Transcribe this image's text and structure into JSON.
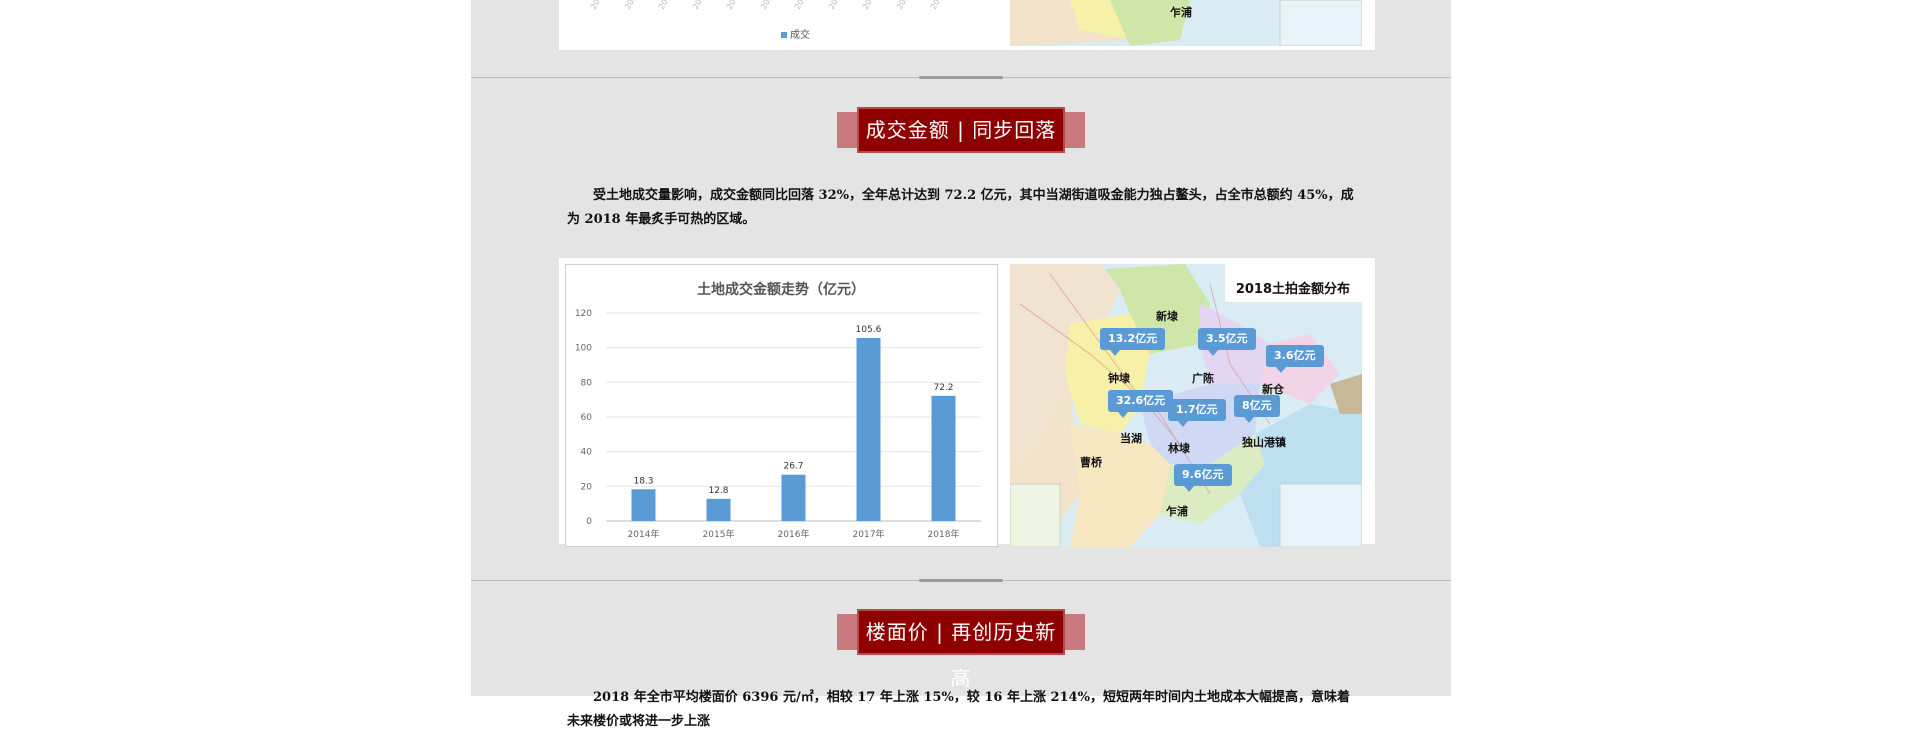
{
  "colors": {
    "column_bg": "#e4e4e4",
    "title_bg": "#8e0000",
    "title_wing": "#c97a7f",
    "bar": "#5b9bd5",
    "callout": "#5b9bd5",
    "page_bg": "#ffffff"
  },
  "top_section": {
    "legend_label": "成交",
    "map_place": "乍浦"
  },
  "section_amount": {
    "heading": "成交金额 | 同步回落",
    "paragraph": "受土地成交量影响，成交金额同比回落 32%，全年总计达到 72.2 亿元，其中当湖街道吸金能力独占鳌头，占全市总额约 45%，成为 2018 年最炙手可热的区域。",
    "chart_title": "土地成交金额走势（亿元）",
    "map_title": "2018土拍金额分布",
    "map_callouts": [
      "13.2亿元",
      "3.5亿元",
      "3.6亿元",
      "32.6亿元",
      "1.7亿元",
      "8亿元",
      "9.6亿元"
    ],
    "map_places": [
      "新埭",
      "钟埭",
      "广陈",
      "新仓",
      "当湖",
      "林埭",
      "独山港镇",
      "曹桥",
      "乍浦"
    ]
  },
  "section_price": {
    "heading": "楼面价 | 再创历史新高",
    "paragraph_partial": "2018 年全市平均楼面价 6396 元/㎡，相较 17 年上涨 15%，较 16 年上涨 214%，短短两年时间内土地成本大幅提高，意味着未来楼价或将进一步上涨"
  },
  "chart_data": {
    "type": "bar",
    "title": "土地成交金额走势（亿元）",
    "categories": [
      "2014年",
      "2015年",
      "2016年",
      "2017年",
      "2018年"
    ],
    "values": [
      18.3,
      12.8,
      26.7,
      105.6,
      72.2
    ],
    "ylim": [
      0,
      120
    ],
    "yticks": [
      0,
      20,
      40,
      60,
      80,
      100,
      120
    ],
    "grid": true,
    "xlabel": "",
    "ylabel": ""
  }
}
